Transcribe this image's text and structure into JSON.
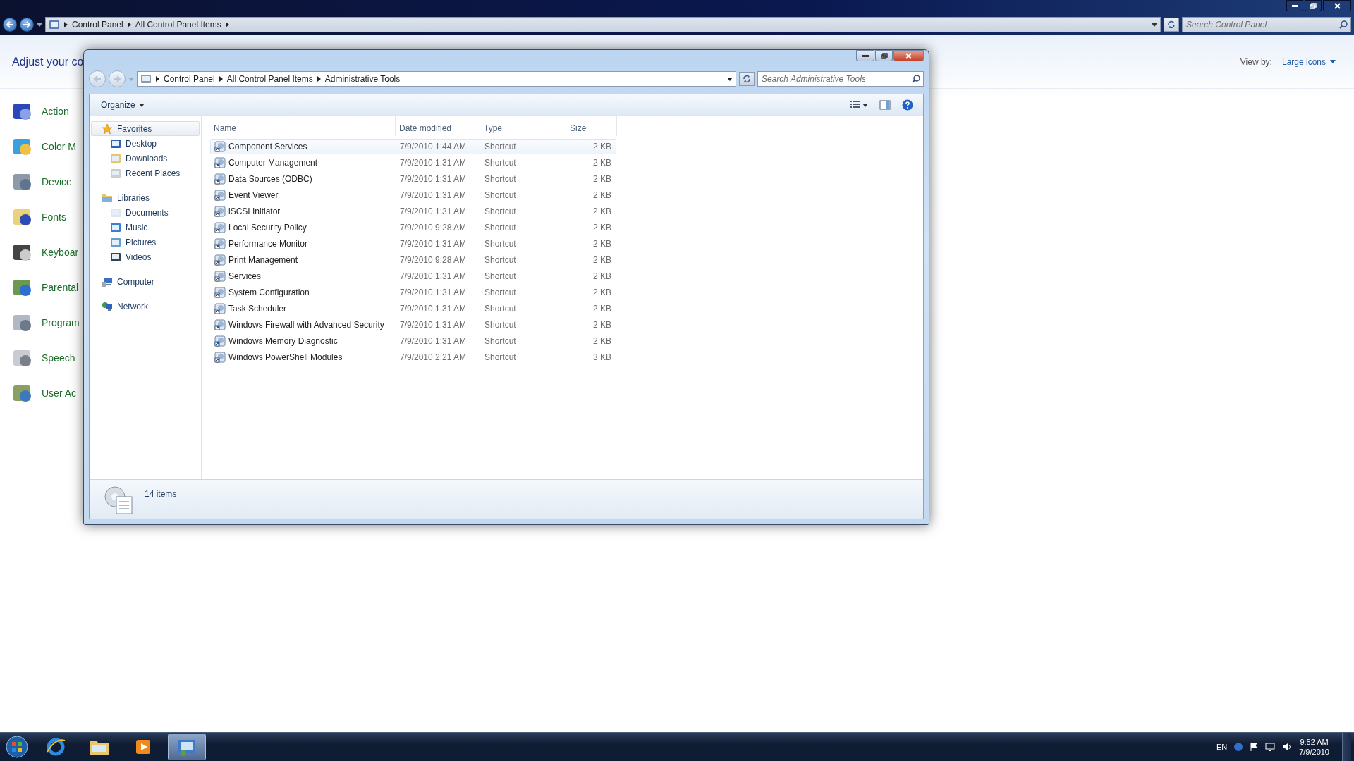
{
  "control_panel": {
    "breadcrumb": [
      "Control Panel",
      "All Control Panel Items"
    ],
    "search": {
      "placeholder": "Search Control Panel"
    },
    "heading": "Adjust your co",
    "view_by": {
      "label": "View by:",
      "value": "Large icons"
    },
    "items": [
      {
        "label": "Action"
      },
      {
        "label": "Color M"
      },
      {
        "label": "Device"
      },
      {
        "label": "Fonts"
      },
      {
        "label": "Keyboar"
      },
      {
        "label": "Parental"
      },
      {
        "label": "Program"
      },
      {
        "label": "Speech"
      },
      {
        "label": "User Ac"
      }
    ]
  },
  "explorer": {
    "breadcrumb": [
      "Control Panel",
      "All Control Panel Items",
      "Administrative Tools"
    ],
    "search": {
      "placeholder": "Search Administrative Tools"
    },
    "organize": "Organize",
    "nav": [
      {
        "label": "Favorites",
        "selected": true,
        "children": [
          {
            "label": "Desktop",
            "selected": false
          },
          {
            "label": "Downloads",
            "selected": false
          },
          {
            "label": "Recent Places",
            "selected": false
          }
        ]
      },
      {
        "label": "Libraries",
        "selected": false,
        "children": [
          {
            "label": "Documents",
            "selected": false
          },
          {
            "label": "Music",
            "selected": false
          },
          {
            "label": "Pictures",
            "selected": false
          },
          {
            "label": "Videos",
            "selected": false
          }
        ]
      },
      {
        "label": "Computer",
        "selected": false
      },
      {
        "label": "Network",
        "selected": false
      }
    ],
    "columns": [
      "Name",
      "Date modified",
      "Type",
      "Size"
    ],
    "rows": [
      {
        "name": "Component Services",
        "date": "7/9/2010 1:44 AM",
        "type": "Shortcut",
        "size": "2 KB",
        "selected": true
      },
      {
        "name": "Computer Management",
        "date": "7/9/2010 1:31 AM",
        "type": "Shortcut",
        "size": "2 KB",
        "selected": false
      },
      {
        "name": "Data Sources (ODBC)",
        "date": "7/9/2010 1:31 AM",
        "type": "Shortcut",
        "size": "2 KB",
        "selected": false
      },
      {
        "name": "Event Viewer",
        "date": "7/9/2010 1:31 AM",
        "type": "Shortcut",
        "size": "2 KB",
        "selected": false
      },
      {
        "name": "iSCSI Initiator",
        "date": "7/9/2010 1:31 AM",
        "type": "Shortcut",
        "size": "2 KB",
        "selected": false
      },
      {
        "name": "Local Security Policy",
        "date": "7/9/2010 9:28 AM",
        "type": "Shortcut",
        "size": "2 KB",
        "selected": false
      },
      {
        "name": "Performance Monitor",
        "date": "7/9/2010 1:31 AM",
        "type": "Shortcut",
        "size": "2 KB",
        "selected": false
      },
      {
        "name": "Print Management",
        "date": "7/9/2010 9:28 AM",
        "type": "Shortcut",
        "size": "2 KB",
        "selected": false
      },
      {
        "name": "Services",
        "date": "7/9/2010 1:31 AM",
        "type": "Shortcut",
        "size": "2 KB",
        "selected": false
      },
      {
        "name": "System Configuration",
        "date": "7/9/2010 1:31 AM",
        "type": "Shortcut",
        "size": "2 KB",
        "selected": false
      },
      {
        "name": "Task Scheduler",
        "date": "7/9/2010 1:31 AM",
        "type": "Shortcut",
        "size": "2 KB",
        "selected": false
      },
      {
        "name": "Windows Firewall with Advanced Security",
        "date": "7/9/2010 1:31 AM",
        "type": "Shortcut",
        "size": "2 KB",
        "selected": false
      },
      {
        "name": "Windows Memory Diagnostic",
        "date": "7/9/2010 1:31 AM",
        "type": "Shortcut",
        "size": "2 KB",
        "selected": false
      },
      {
        "name": "Windows PowerShell Modules",
        "date": "7/9/2010 2:21 AM",
        "type": "Shortcut",
        "size": "3 KB",
        "selected": false
      }
    ],
    "status": "14 items"
  },
  "taskbar": {
    "buttons": [
      {
        "selected": false
      },
      {
        "selected": false
      },
      {
        "selected": false
      },
      {
        "selected": true
      }
    ],
    "language": "EN",
    "time": "9:52 AM",
    "date": "7/9/2010"
  }
}
